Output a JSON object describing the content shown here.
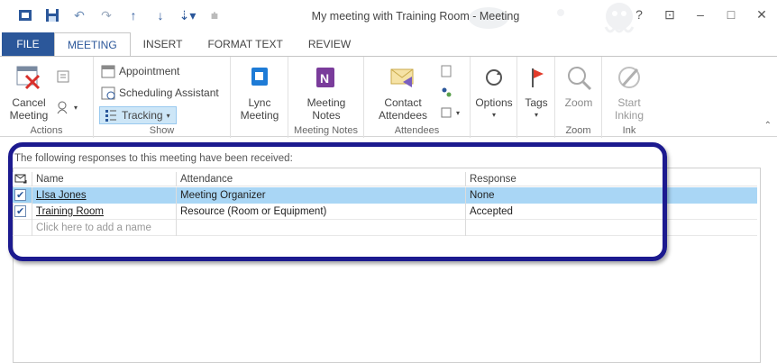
{
  "window": {
    "title": "My meeting with Training Room - Meeting"
  },
  "tabs": [
    "FILE",
    "MEETING",
    "INSERT",
    "FORMAT TEXT",
    "REVIEW"
  ],
  "ribbon": {
    "actions": {
      "cancel_label": "Cancel Meeting",
      "group_label": "Actions"
    },
    "show": {
      "appointment": "Appointment",
      "scheduling": "Scheduling Assistant",
      "tracking": "Tracking",
      "group_label": "Show"
    },
    "lync": {
      "label": "Lync Meeting"
    },
    "meeting_notes": {
      "label": "Meeting Notes",
      "group_label": "Meeting Notes"
    },
    "attendees": {
      "contact_label": "Contact Attendees",
      "group_label": "Attendees"
    },
    "options": {
      "label": "Options"
    },
    "tags": {
      "label": "Tags"
    },
    "zoom": {
      "label": "Zoom",
      "group_label": "Zoom"
    },
    "ink": {
      "label": "Start Inking",
      "group_label": "Ink"
    }
  },
  "tracking": {
    "info": "The following responses to this meeting have been received:",
    "columns": [
      "Name",
      "Attendance",
      "Response"
    ],
    "rows": [
      {
        "name": "LIsa Jones",
        "attendance": "Meeting Organizer",
        "response": "None",
        "selected": true
      },
      {
        "name": "Training Room",
        "attendance": "Resource (Room or Equipment)",
        "response": "Accepted",
        "selected": false
      }
    ],
    "add_placeholder": "Click here to add a name"
  },
  "colors": {
    "accent": "#2b579a",
    "callout": "#1c1a8f",
    "selection": "#9bcff1"
  }
}
